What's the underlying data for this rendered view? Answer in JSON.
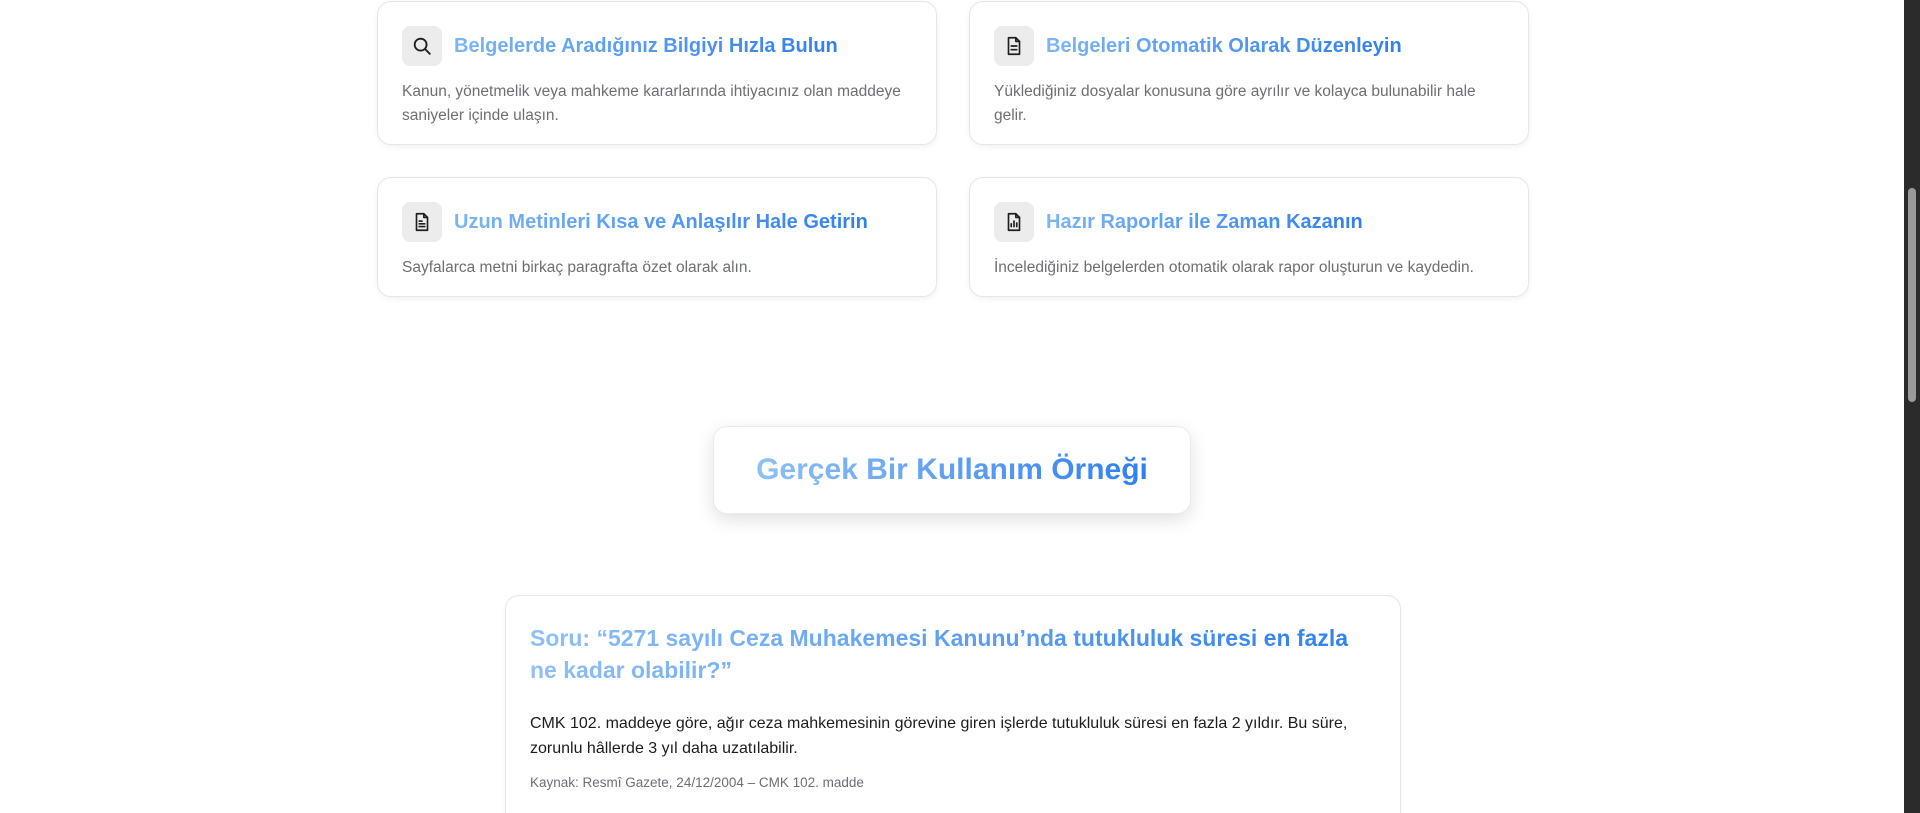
{
  "features": [
    {
      "icon": "search-icon",
      "title": "Belgelerde Aradığınız Bilgiyi Hızla Bulun",
      "description": "Kanun, yönetmelik veya mahkeme kararlarında ihtiyacınız olan maddeye saniyeler içinde ulaşın."
    },
    {
      "icon": "document-icon",
      "title": "Belgeleri Otomatik Olarak Düzenleyin",
      "description": "Yüklediğiniz dosyalar konusuna göre ayrılır ve kolayca bulunabilir hale gelir."
    },
    {
      "icon": "document-text-icon",
      "title": "Uzun Metinleri Kısa ve Anlaşılır Hale Getirin",
      "description": "Sayfalarca metni birkaç paragrafta özet olarak alın."
    },
    {
      "icon": "report-chart-icon",
      "title": "Hazır Raporlar ile Zaman Kazanın",
      "description": "İncelediğiniz belgelerden otomatik olarak rapor oluşturun ve kaydedin."
    }
  ],
  "example": {
    "heading": "Gerçek Bir Kullanım Örneği"
  },
  "qa": {
    "question": "Soru: “5271 sayılı Ceza Muhakemesi Kanunu’nda tutukluluk süresi en fazla ne kadar olabilir?”",
    "answer": "CMK 102. maddeye göre, ağır ceza mahkemesinin görevine giren işlerde tutukluluk süresi en fazla 2 yıldır. Bu süre, zorunlu hâllerde 3 yıl daha uzatılabilir.",
    "source": "Kaynak: Resmî Gazete, 24/12/2004 – CMK 102. madde"
  },
  "colors": {
    "accent_light": "#7db5f5",
    "accent": "#2f7ff0",
    "icon_bg": "#ececec",
    "muted_text": "#6b6f76"
  }
}
